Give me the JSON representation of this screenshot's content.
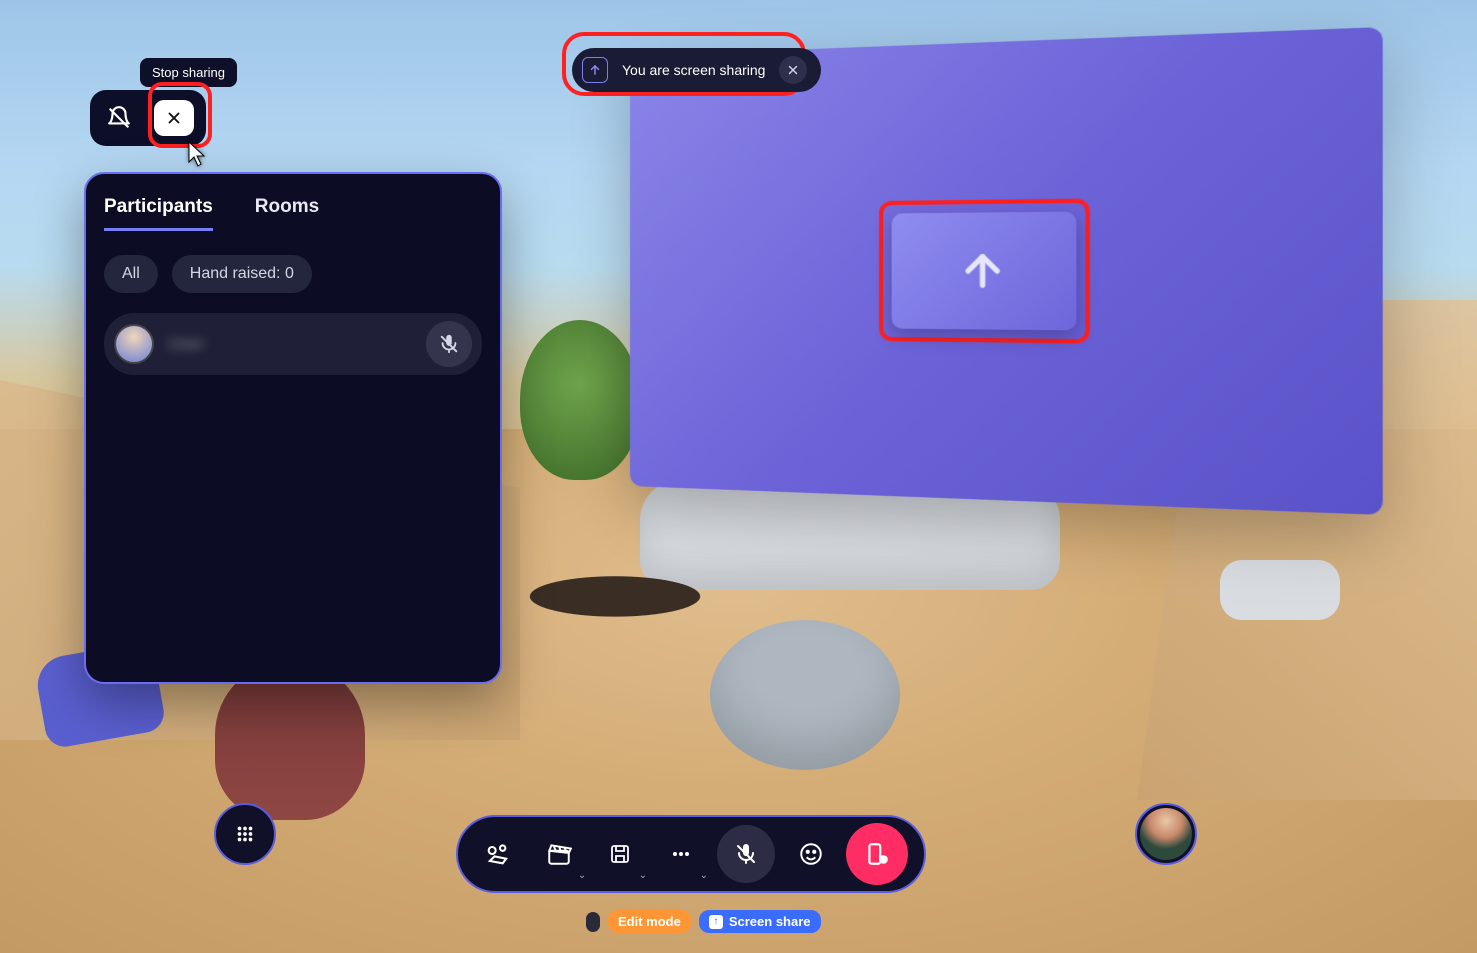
{
  "tooltip": {
    "stopSharing": "Stop sharing"
  },
  "banner": {
    "text": "You are screen sharing"
  },
  "panel": {
    "tabs": {
      "participants": "Participants",
      "rooms": "Rooms"
    },
    "filters": {
      "all": "All",
      "handRaised": "Hand raised: 0"
    },
    "participants": [
      {
        "name": "User"
      }
    ]
  },
  "status": {
    "editMode": "Edit mode",
    "screenShare": "Screen share"
  }
}
